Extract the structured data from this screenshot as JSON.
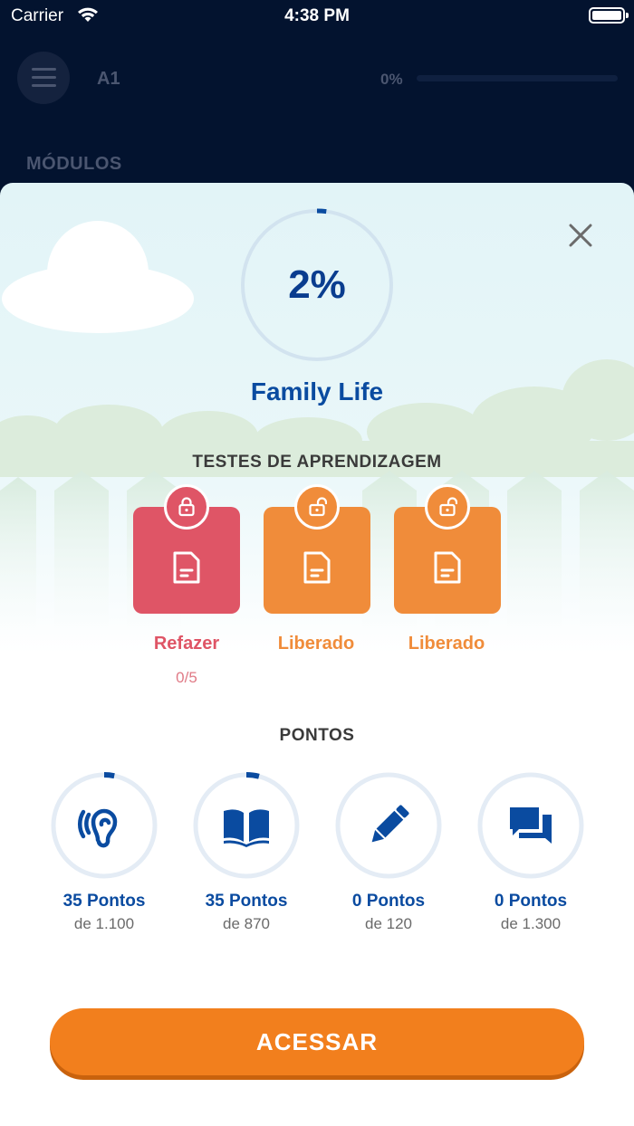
{
  "status_bar": {
    "carrier": "Carrier",
    "time": "4:38 PM"
  },
  "header": {
    "level": "A1",
    "progress_text": "0%",
    "progress": 0.0
  },
  "modules_title": "MÓDULOS",
  "module": {
    "progress_text": "2%",
    "progress": 0.02,
    "name": "Family Life"
  },
  "tests": {
    "title": "TESTES DE APRENDIZAGEM",
    "items": [
      {
        "status": "Refazer",
        "progress": "0/5",
        "color": "#df5566",
        "lock": "lock-closed-icon"
      },
      {
        "status": "Liberado",
        "color": "#f08c3a",
        "lock": "lock-open-icon"
      },
      {
        "status": "Liberado",
        "color": "#f08c3a",
        "lock": "lock-open-icon"
      }
    ]
  },
  "points": {
    "title": "PONTOS",
    "items": [
      {
        "icon": "listening-ear-icon",
        "points": "35 Pontos",
        "total": "de 1.100",
        "fraction": 0.032
      },
      {
        "icon": "reading-book-icon",
        "points": "35 Pontos",
        "total": "de 870",
        "fraction": 0.04
      },
      {
        "icon": "writing-pencil-icon",
        "points": "0 Pontos",
        "total": "de 120",
        "fraction": 0.0
      },
      {
        "icon": "speaking-chat-icon",
        "points": "0 Pontos",
        "total": "de 1.300",
        "fraction": 0.0
      }
    ]
  },
  "cta": {
    "label": "ACESSAR"
  },
  "colors": {
    "accent_orange": "#f27f1d",
    "brand_blue": "#0a4ba0",
    "retry_red": "#df5566",
    "navy_bg": "#03132f"
  }
}
